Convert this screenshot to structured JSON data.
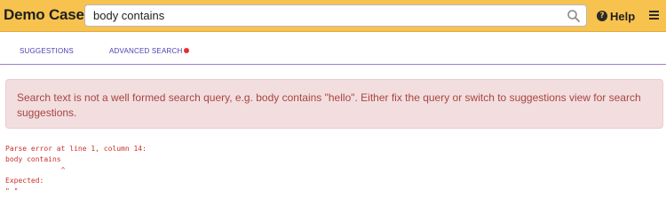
{
  "app": {
    "title": "Demo Case"
  },
  "search": {
    "value": "body contains",
    "icon": "search-icon"
  },
  "header": {
    "help_label": "Help",
    "help_icon": "question-circle-icon",
    "menu_icon": "hamburger-menu-icon"
  },
  "tabs": [
    {
      "label": "SUGGESTIONS"
    },
    {
      "label": "ADVANCED SEARCH",
      "indicator_color": "#e53030"
    }
  ],
  "alert": {
    "message": "Search text is not a well formed search query, e.g. body contains \"hello\". Either fix the query or switch to suggestions view for search suggestions."
  },
  "error": {
    "lines": [
      "Parse error at line 1, column 14:",
      "body contains",
      "             ^",
      "Expected:",
      "\" \""
    ]
  },
  "colors": {
    "header_bg": "#f7c24e",
    "tab_text": "#4a3fb0",
    "alert_bg": "#f2dede",
    "alert_text": "#a94442",
    "error_text": "#c9302c"
  }
}
